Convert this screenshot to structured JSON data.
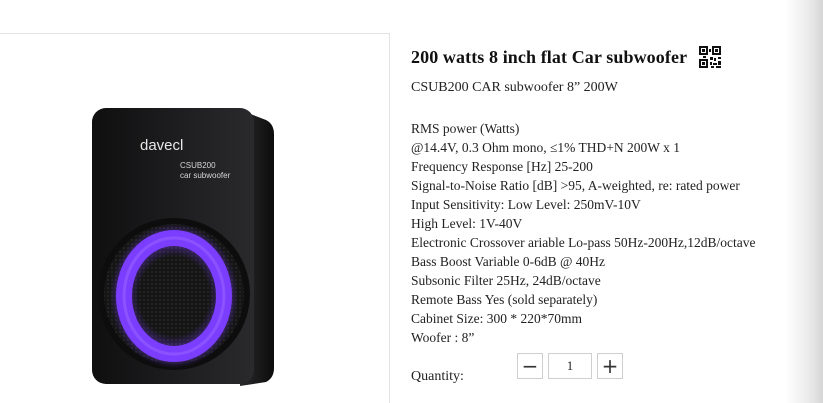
{
  "product": {
    "title": "200 watts 8 inch flat Car subwoofer",
    "subtitle": "CSUB200 CAR subwoofer 8” 200W",
    "image": {
      "brand_text": "davecl",
      "model_text": "CSUB200",
      "type_text": "car subwoofer"
    },
    "specs": [
      "RMS power (Watts)",
      "@14.4V, 0.3 Ohm mono, ≤1% THD+N 200W x 1",
      "Frequency Response [Hz] 25-200",
      "Signal-to-Noise Ratio [dB] >95, A-weighted, re: rated power",
      "Input Sensitivity: Low Level: 250mV-10V",
      "High Level: 1V-40V",
      "Electronic Crossover ariable Lo-pass 50Hz-200Hz,12dB/octave",
      "Bass Boost Variable 0-6dB @ 40Hz",
      "Subsonic Filter 25Hz, 24dB/octave",
      "Remote Bass Yes (sold separately)",
      "Cabinet Size: 300 * 220*70mm",
      "Woofer : 8”"
    ],
    "quantity": {
      "label": "Quantity:",
      "value": "1",
      "decrement_symbol": "−",
      "increment_symbol": "+"
    }
  },
  "icons": {
    "qr": "qr-code-icon",
    "minus": "minus-icon",
    "plus": "plus-icon"
  },
  "colors": {
    "accent_ring": "#7b3dff",
    "device_body": "#1b1b1d",
    "border": "#cfcfcf"
  }
}
